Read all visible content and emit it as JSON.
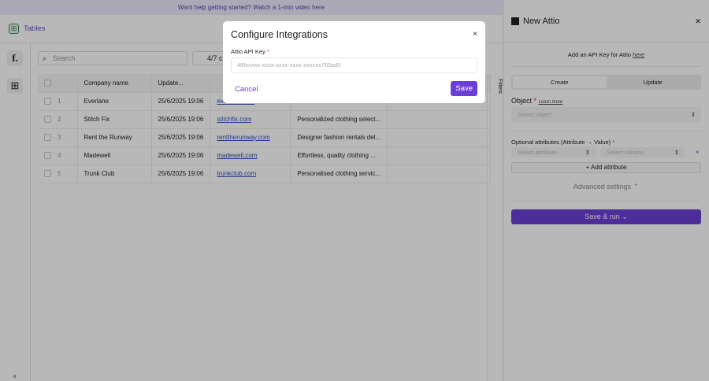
{
  "banner": "Want help getting started? Watch a 1-min video here",
  "header": {
    "title": "Tables"
  },
  "search": {
    "placeholder": "Search"
  },
  "columns_button": "4/7 c",
  "table": {
    "headers": [
      "Company name",
      "Update...",
      ""
    ],
    "rows": [
      {
        "n": "1",
        "company": "Everlane",
        "updated": "25/6/2025 19:06",
        "url": "everlane.com",
        "desc": ""
      },
      {
        "n": "2",
        "company": "Stitch Fix",
        "updated": "25/6/2025 19:06",
        "url": "stitchfix.com",
        "desc": "Personalized clothing select..."
      },
      {
        "n": "3",
        "company": "Rent the Runway",
        "updated": "25/6/2025 19:06",
        "url": "renttherunway.com",
        "desc": "Designer fashion rentals del..."
      },
      {
        "n": "4",
        "company": "Madewell",
        "updated": "25/6/2025 19:06",
        "url": "madewell.com",
        "desc": "Effortless, quality clothing ..."
      },
      {
        "n": "5",
        "company": "Trunk Club",
        "updated": "25/6/2025 19:06",
        "url": "trunkclub.com",
        "desc": "Personalised clothing servic..."
      }
    ]
  },
  "filters": "Filters",
  "panel": {
    "title": "New Attio",
    "api_text": "Add an API Key for Attio ",
    "api_link": "here",
    "tabs": [
      "Create",
      "Update"
    ],
    "object_label": "Object",
    "learn_more": "Learn more",
    "object_placeholder": "Select object",
    "attrs_label": "Optional attributes (Attribute → Value)",
    "attr_placeholder": "Select attribute",
    "col_placeholder": "Select column",
    "add_attr": "+ Add attribute",
    "advanced": "Advanced settings ⌃",
    "run": "Save & run ⌄"
  },
  "modal": {
    "title": "Configure Integrations",
    "key_label": "Attio API Key",
    "key_placeholder": "48fxxxxx-xxxx-xxxx-xxxx-xxxxxx765ad0",
    "cancel": "Cancel",
    "save": "Save"
  }
}
